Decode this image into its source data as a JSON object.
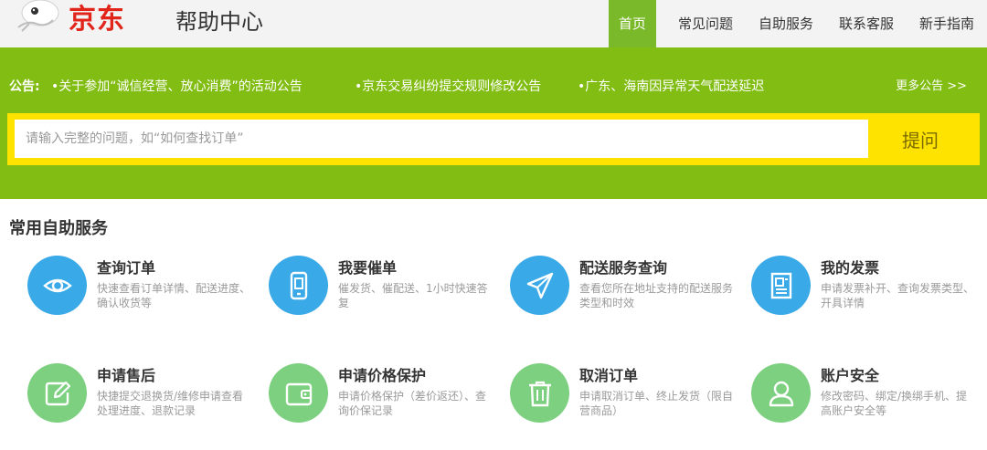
{
  "header": {
    "logo_text": "京东",
    "title": "帮助中心",
    "nav": [
      {
        "label": "首页",
        "active": true
      },
      {
        "label": "常见问题"
      },
      {
        "label": "自助服务"
      },
      {
        "label": "联系客服"
      },
      {
        "label": "新手指南"
      }
    ]
  },
  "notice": {
    "label": "公告:",
    "items": [
      "•关于参加“诚信经营、放心消费”的活动公告",
      "•京东交易纠纷提交规则修改公告",
      "•广东、海南因异常天气配送延迟"
    ],
    "more": "更多公告 >>"
  },
  "search": {
    "placeholder": "请输入完整的问题，如“如何查找订单”",
    "value": "",
    "button": "提问"
  },
  "services": {
    "title": "常用自助服务",
    "items": [
      {
        "name": "查询订单",
        "desc": "快速查看订单详情、配送进度、确认收货等",
        "icon": "eye-icon",
        "color": "#39a9e8"
      },
      {
        "name": "我要催单",
        "desc": "催发货、催配送、1小时快速答复",
        "icon": "phone-icon",
        "color": "#39a9e8"
      },
      {
        "name": "配送服务查询",
        "desc": "查看您所在地址支持的配送服务类型和时效",
        "icon": "paper-plane-icon",
        "color": "#39a9e8"
      },
      {
        "name": "我的发票",
        "desc": "申请发票补开、查询发票类型、开具详情",
        "icon": "invoice-icon",
        "color": "#39a9e8"
      },
      {
        "name": "申请售后",
        "desc": "快捷提交退换货/维修申请查看处理进度、退款记录",
        "icon": "edit-icon",
        "color": "#7cd07f"
      },
      {
        "name": "申请价格保护",
        "desc": "申请价格保护（差价返还）、查询价保记录",
        "icon": "wallet-icon",
        "color": "#7cd07f"
      },
      {
        "name": "取消订单",
        "desc": "申请取消订单、终止发货（限自营商品）",
        "icon": "trash-icon",
        "color": "#7cd07f"
      },
      {
        "name": "账户安全",
        "desc": "修改密码、绑定/换绑手机、提高账户安全等",
        "icon": "user-icon",
        "color": "#7cd07f"
      }
    ]
  },
  "colors": {
    "brand_red": "#e1251b",
    "banner_green": "#82bd13",
    "search_yellow": "#ffe300",
    "icon_blue": "#39a9e8",
    "icon_green": "#7cd07f"
  }
}
